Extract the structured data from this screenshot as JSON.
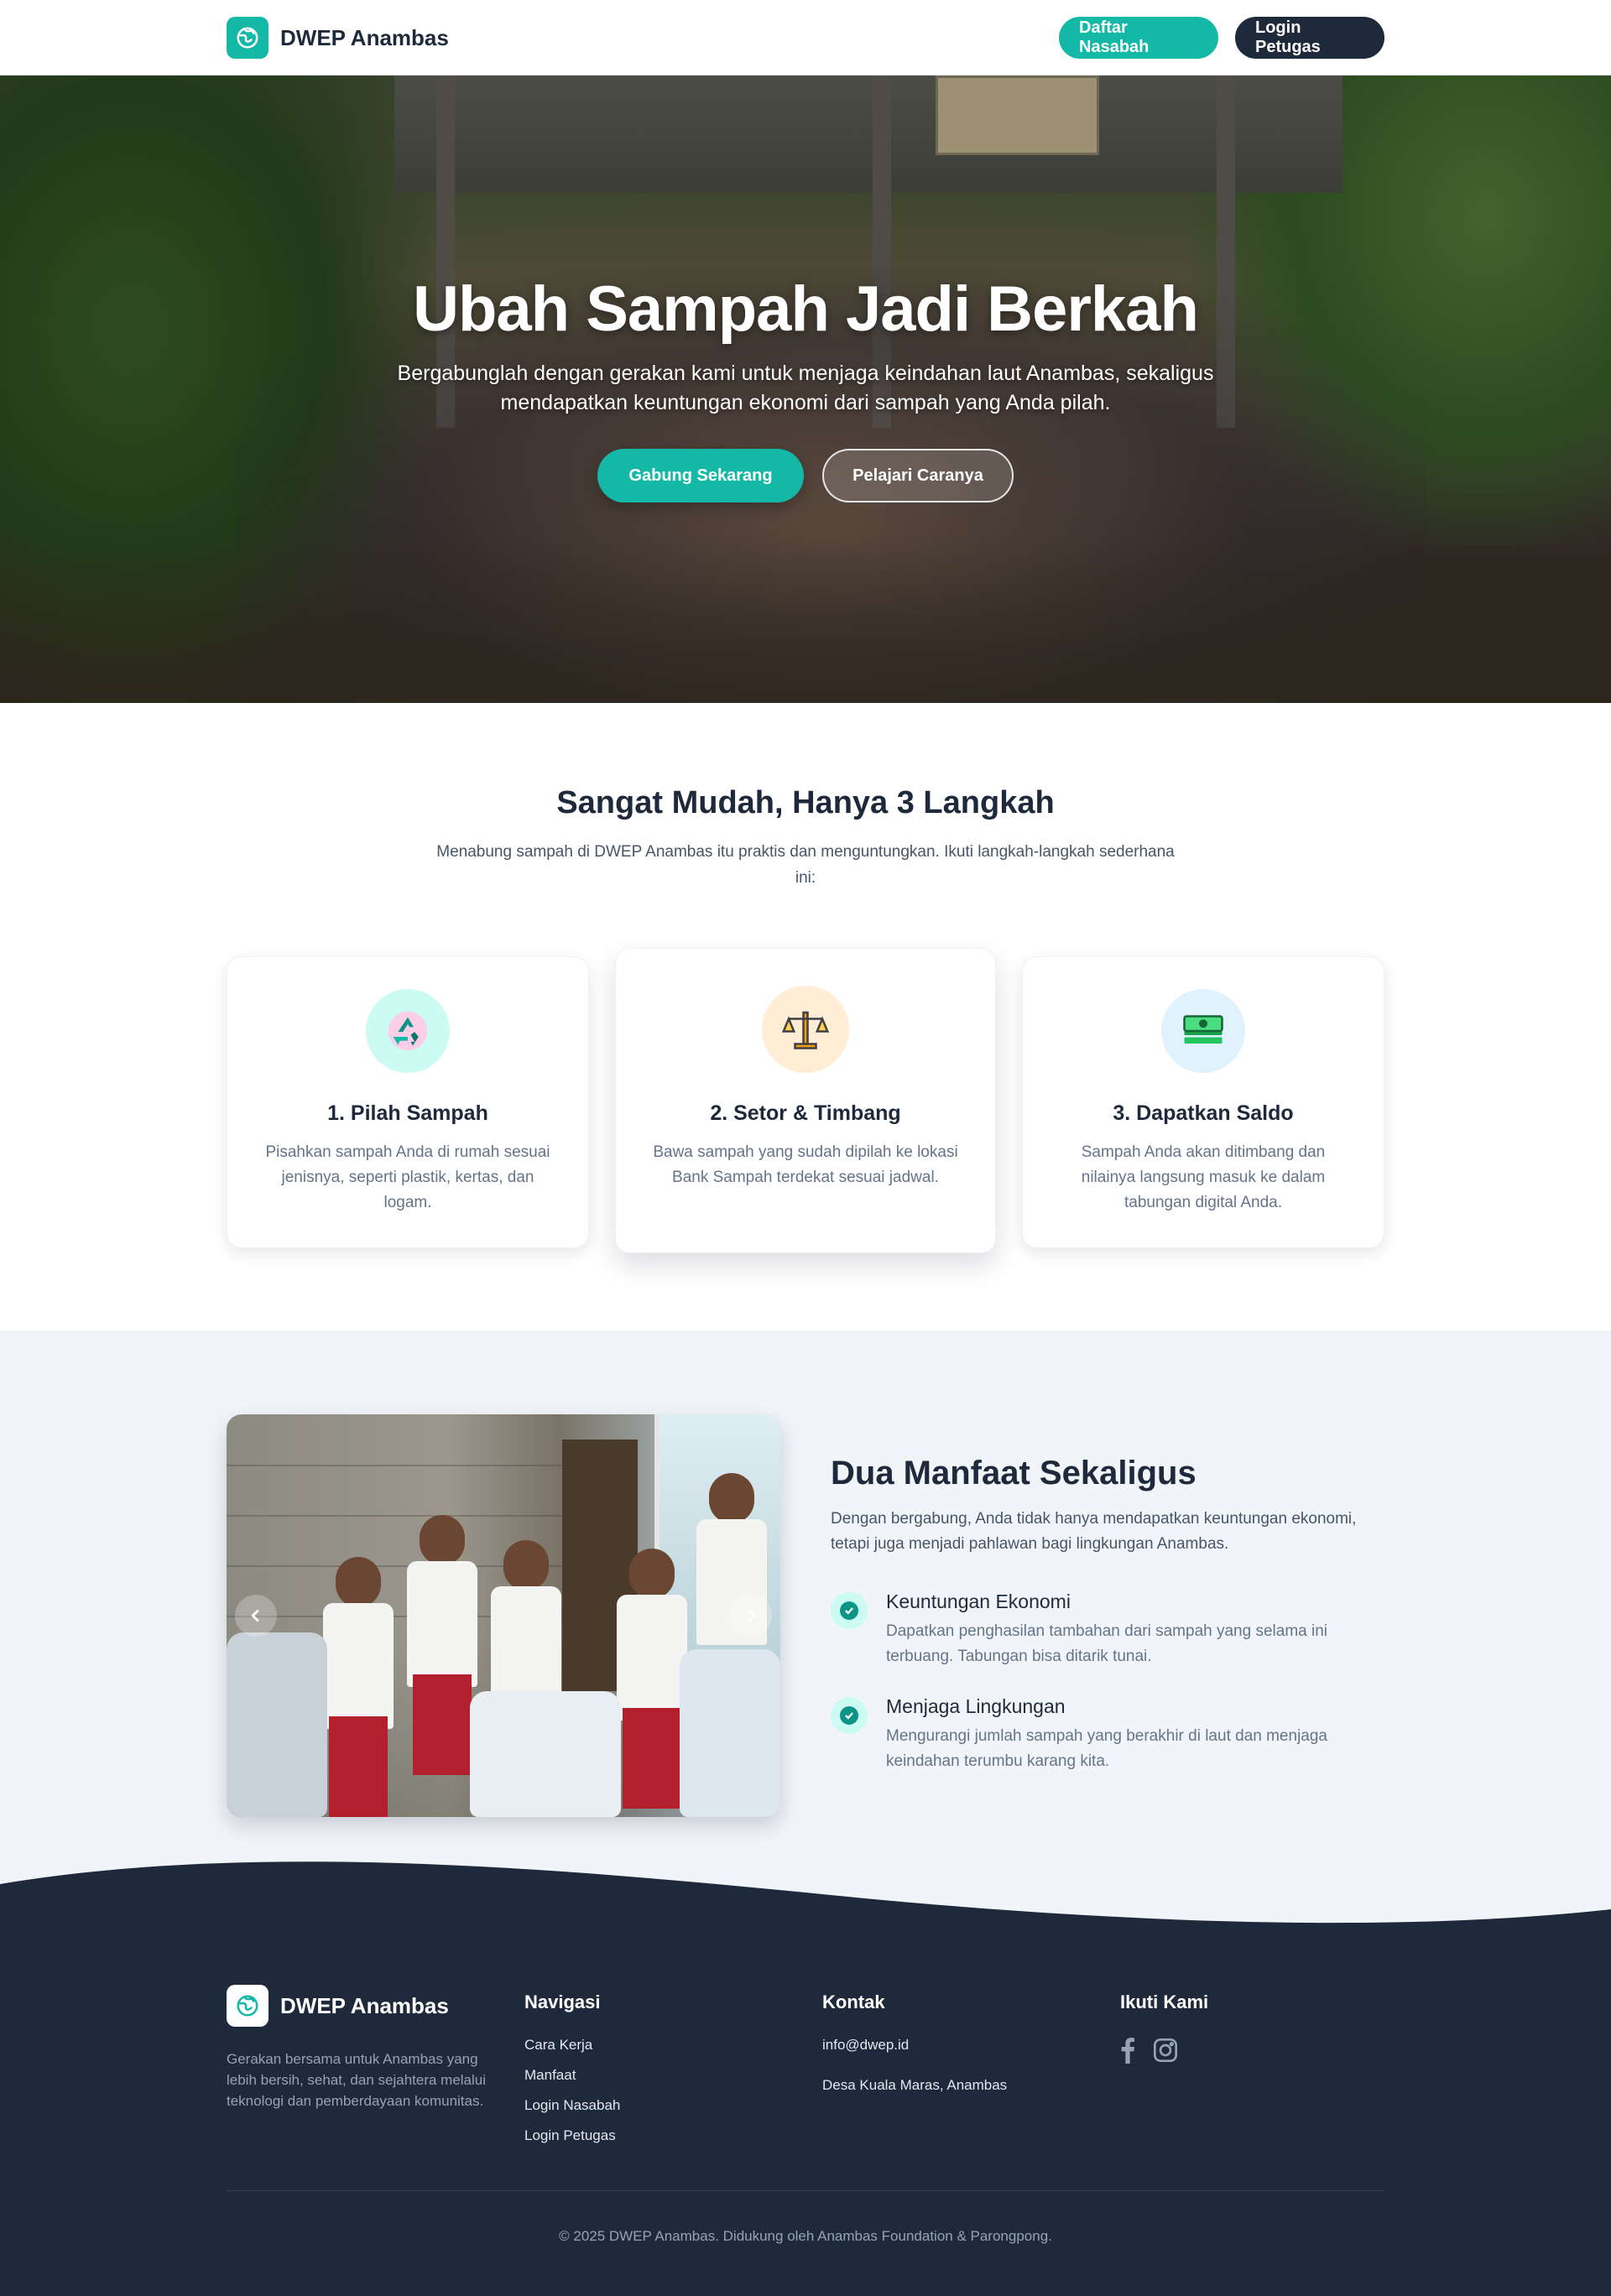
{
  "navbar": {
    "brand": "DWEP Anambas",
    "register_label": "Daftar Nasabah",
    "login_label": "Login Petugas",
    "brand_icon": "globe-icon",
    "accent_color": "#14b8a6",
    "dark_color": "#1e293b"
  },
  "hero": {
    "title": "Ubah Sampah Jadi Berkah",
    "subtitle": "Bergabunglah dengan gerakan kami untuk menjaga keindahan laut Anambas, sekaligus mendapatkan keuntungan ekonomi dari sampah yang Anda pilah.",
    "primary_label": "Gabung Sekarang",
    "secondary_label": "Pelajari Caranya"
  },
  "steps": {
    "title": "Sangat Mudah, Hanya 3 Langkah",
    "subtitle": "Menabung sampah di DWEP Anambas itu praktis dan menguntungkan. Ikuti langkah-langkah sederhana ini:",
    "items": [
      {
        "title": "1. Pilah Sampah",
        "desc": "Pisahkan sampah Anda di rumah sesuai jenisnya, seperti plastik, kertas, dan logam.",
        "icon": "recycle-icon"
      },
      {
        "title": "2. Setor & Timbang",
        "desc": "Bawa sampah yang sudah dipilah ke lokasi Bank Sampah terdekat sesuai jadwal.",
        "icon": "scale-icon"
      },
      {
        "title": "3. Dapatkan Saldo",
        "desc": "Sampah Anda akan ditimbang dan nilainya langsung masuk ke dalam tabungan digital Anda.",
        "icon": "money-icon"
      }
    ]
  },
  "benefits": {
    "title": "Dua Manfaat Sekaligus",
    "intro": "Dengan bergabung, Anda tidak hanya mendapatkan keuntungan ekonomi, tetapi juga menjadi pahlawan bagi lingkungan Anambas.",
    "items": [
      {
        "title": "Keuntungan Ekonomi",
        "desc": "Dapatkan penghasilan tambahan dari sampah yang selama ini terbuang. Tabungan bisa ditarik tunai."
      },
      {
        "title": "Menjaga Lingkungan",
        "desc": "Mengurangi jumlah sampah yang berakhir di laut dan menjaga keindahan terumbu karang kita."
      }
    ],
    "prev_icon": "chevron-left-icon",
    "next_icon": "chevron-right-icon"
  },
  "footer": {
    "brand": "DWEP Anambas",
    "about": "Gerakan bersama untuk Anambas yang lebih bersih, sehat, dan sejahtera melalui teknologi dan pemberdayaan komunitas.",
    "nav_title": "Navigasi",
    "nav_links": [
      "Cara Kerja",
      "Manfaat",
      "Login Nasabah",
      "Login Petugas"
    ],
    "contact_title": "Kontak",
    "contact_items": [
      "info@dwep.id",
      "Desa Kuala Maras, Anambas"
    ],
    "social_title": "Ikuti Kami",
    "social_icons": [
      "facebook-icon",
      "instagram-icon"
    ],
    "copyright": "© 2025 DWEP Anambas. Didukung oleh Anambas Foundation & Parongpong."
  }
}
